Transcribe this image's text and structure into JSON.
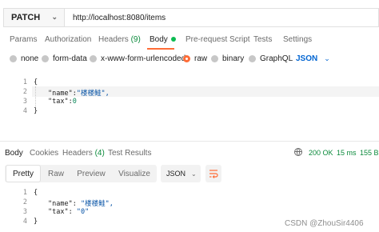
{
  "request": {
    "method": "PATCH",
    "url": "http://localhost:8080/items"
  },
  "request_tabs": [
    {
      "label": "Params"
    },
    {
      "label": "Authorization"
    },
    {
      "label": "Headers",
      "count": "(9)"
    },
    {
      "label": "Body"
    },
    {
      "label": "Pre-request Script"
    },
    {
      "label": "Tests"
    },
    {
      "label": "Settings"
    }
  ],
  "body_modes": [
    "none",
    "form-data",
    "x-www-form-urlencoded",
    "raw",
    "binary",
    "GraphQL"
  ],
  "body_mode_selected": "raw",
  "body_language": "JSON",
  "request_body": {
    "line_numbers": [
      "1",
      "2",
      "3",
      "4"
    ],
    "open": "{",
    "name_key": "\"name\":",
    "name_value": "\"楼楼鲑\",",
    "tax_key": "\"tax\":",
    "tax_value": "0",
    "close": "}"
  },
  "response_tabs": [
    {
      "label": "Body"
    },
    {
      "label": "Cookies"
    },
    {
      "label": "Headers",
      "count": "(4)"
    },
    {
      "label": "Test Results"
    }
  ],
  "response_status": {
    "status": "200 OK",
    "time": "15 ms",
    "size": "155 B"
  },
  "view_modes": [
    "Pretty",
    "Raw",
    "Preview",
    "Visualize"
  ],
  "view_format": "JSON",
  "response_body": {
    "line_numbers": [
      "1",
      "2",
      "3",
      "4"
    ],
    "open": "{",
    "name_key": "\"name\":",
    "name_value": "\"楼楼鲑\",",
    "tax_key": "\"tax\":",
    "tax_value": "\"0\"",
    "close": "}"
  },
  "watermark": "CSDN @ZhouSir4406",
  "colors": {
    "accent": "#ff6c37",
    "active_dot": "#0cbb52",
    "status_green": "#0b8a3b",
    "link_blue": "#0265d2"
  }
}
